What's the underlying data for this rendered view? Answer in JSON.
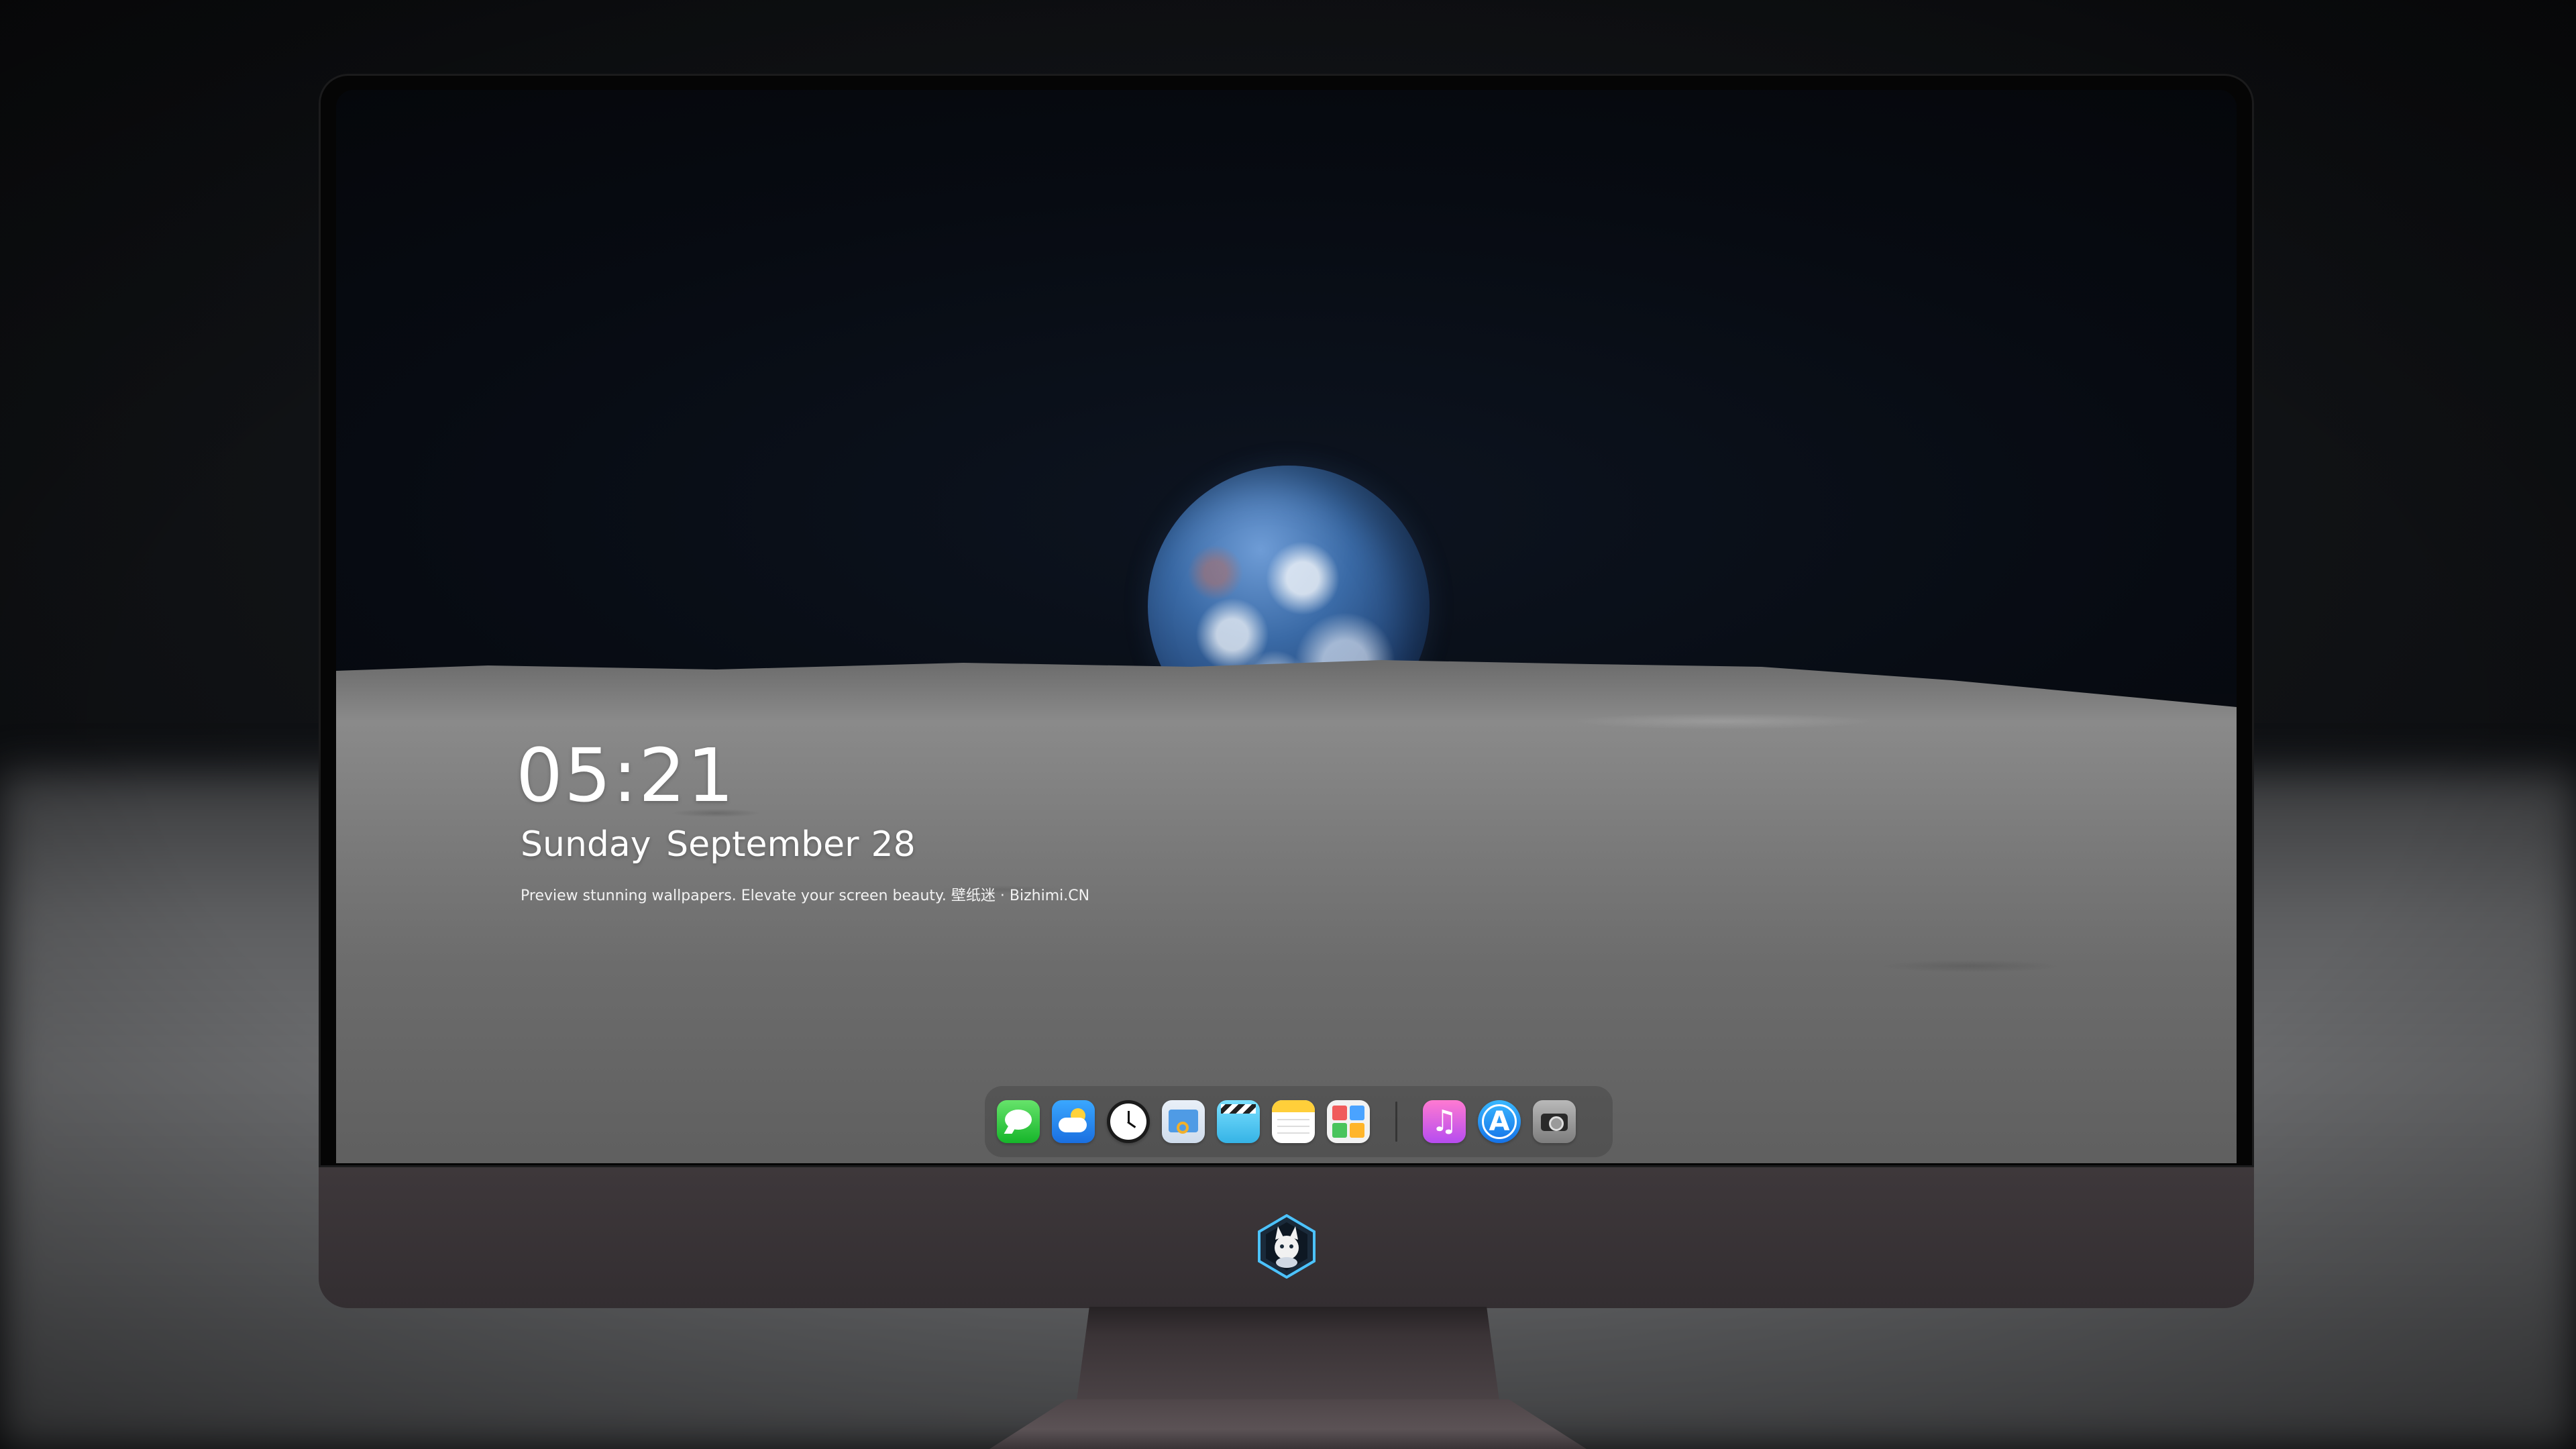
{
  "lock_screen": {
    "time": "05:21",
    "weekday": "Sunday",
    "month": "September",
    "day": "28",
    "caption": "Preview stunning wallpapers. Elevate your screen beauty. 壁纸迷 · Bizhimi.CN"
  },
  "dock": {
    "apps": [
      {
        "name": "messages-icon",
        "color": "#28c840"
      },
      {
        "name": "weather-icon",
        "color": "#2a8cf5"
      },
      {
        "name": "clock-icon",
        "color": "#1b1b1b"
      },
      {
        "name": "preview-icon",
        "color": "#4f9be5"
      },
      {
        "name": "clips-icon",
        "color": "#35b3e6"
      },
      {
        "name": "notes-icon",
        "color": "#ffcf3a"
      },
      {
        "name": "calculator-icon",
        "color": "#f2f2f2"
      },
      {
        "name": "music-icon",
        "color": "#d05ce6"
      },
      {
        "name": "app-store-icon",
        "color": "#1f86f0"
      },
      {
        "name": "camera-icon",
        "color": "#9a9a9a"
      }
    ]
  },
  "monitor": {
    "logo_icon": "fox-mascot-logo",
    "bezel_color": "#050505",
    "chin_color": "#3a3437"
  }
}
